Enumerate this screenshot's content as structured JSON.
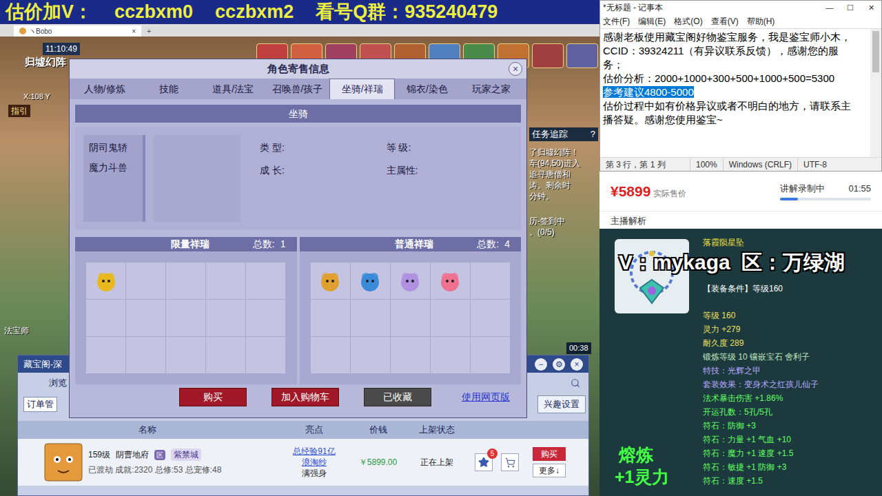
{
  "banner": {
    "parts": [
      "估价加V：",
      "cczbxm0",
      "cczbxm2",
      "看号Q群：935240479"
    ]
  },
  "game": {
    "tab": "ヽBobo",
    "tab_close": "×",
    "tab_add": "+",
    "hud": {
      "time": "11:10:49",
      "location": "归墟幻阵",
      "coords": "X:108 Y",
      "guide": "指引",
      "timer": "00:38",
      "npc": "法宝师"
    },
    "quest": {
      "title": "任务追踪",
      "help": "?",
      "lines": [
        "了归墟幻阵！",
        "车(94,50)进入",
        "追寻唐僧和",
        "涛。剩余时",
        "分钟。"
      ]
    },
    "calendar": [
      "历-签到中",
      "。(0/5)"
    ]
  },
  "dialog": {
    "title": "角色寄售信息",
    "close": "×",
    "tabs": [
      {
        "label": "人物/修炼",
        "selected": false
      },
      {
        "label": "技能",
        "selected": false
      },
      {
        "label": "道具/法宝",
        "selected": false
      },
      {
        "label": "召唤兽/孩子",
        "selected": false
      },
      {
        "label": "坐骑/祥瑞",
        "selected": true
      },
      {
        "label": "锦衣/染色",
        "selected": false
      },
      {
        "label": "玩家之家",
        "selected": false
      }
    ],
    "section": "坐骑",
    "mounts": [
      {
        "name": "阴司鬼轿",
        "selected": false
      },
      {
        "name": "魔力斗兽",
        "selected": false
      }
    ],
    "fields": [
      "类 型:",
      "等 级:",
      "成 长:",
      "主属性:"
    ],
    "limited": {
      "title": "限量祥瑞",
      "count_label": "总数:",
      "count": "1",
      "items": [
        {
          "color": "#e8b820"
        }
      ]
    },
    "normal": {
      "title": "普通祥瑞",
      "count_label": "总数:",
      "count": "4",
      "items": [
        {
          "color": "#e0a030"
        },
        {
          "color": "#3a8ad8"
        },
        {
          "color": "#b090e0"
        },
        {
          "color": "#f07090"
        }
      ]
    },
    "buttons": [
      {
        "label": "购买",
        "kind": "red"
      },
      {
        "label": "加入购物车",
        "kind": "red"
      },
      {
        "label": "已收藏",
        "kind": "gray"
      },
      {
        "label": "使用网页版",
        "kind": "link"
      }
    ]
  },
  "market": {
    "title": "藏宝阁-深",
    "window_buttons": [
      "−",
      "⚙",
      "×"
    ],
    "browse": "浏览",
    "orders": "订单管",
    "interest": "兴趣设置",
    "columns": [
      "名称",
      "亮点",
      "价钱",
      "上架状态"
    ],
    "rows": [
      {
        "level": "159级",
        "school": "阴曹地府",
        "tag": "区",
        "server": "紫禁城",
        "detail": "已渡劫 成就:2320 总修:53 总宠修:48",
        "highlights": [
          {
            "text": "总经验91亿",
            "link": true
          },
          {
            "text": "浪淘纱",
            "link": true
          },
          {
            "text": "满强身",
            "link": false
          }
        ],
        "price": "￥5899.00",
        "status": "正在上架",
        "stars": "5",
        "buy": "购买",
        "more": "更多↓"
      }
    ]
  },
  "notepad": {
    "title": "*无标题 - 记事本",
    "controls": [
      "—",
      "☐",
      "✕"
    ],
    "menu": [
      "文件(F)",
      "编辑(E)",
      "格式(O)",
      "查看(V)",
      "帮助(H)"
    ],
    "lines": [
      {
        "text": "感谢老板使用藏宝阁好物鉴宝服务，我是鉴宝师小木，",
        "selected": false
      },
      {
        "text": "CCID：39324211（有异议联系反馈），感谢您的服",
        "selected": false
      },
      {
        "text": "务；",
        "selected": false
      },
      {
        "text": "估价分析：2000+1000+300+500+1000+500=5300",
        "selected": false
      },
      {
        "text": "参考建议4800-5000",
        "selected": true
      },
      {
        "text": "估价过程中如有价格异议或者不明白的地方，请联系主",
        "selected": false
      },
      {
        "text": "播答疑。感谢您使用鉴宝~",
        "selected": false
      }
    ],
    "status": [
      "第 3 行，第 1 列",
      "100%",
      "Windows (CRLF)",
      "UTF-8"
    ]
  },
  "sale": {
    "price": "¥5899",
    "price_label": "实际售价",
    "recording": "讲解录制中",
    "time": "01:55",
    "level": 0.2,
    "section": "主播解析"
  },
  "tooltip": {
    "overlay": "V：mykaga  区：万绿湖",
    "name": "落霞陨星坠",
    "requirement": "【装备条件】等级160",
    "stats": [
      {
        "text": "等级 160",
        "color": "#f0e060"
      },
      {
        "text": "灵力 +279",
        "color": "#f0e060"
      },
      {
        "text": "耐久度 289",
        "color": "#f0e060"
      },
      {
        "text": "锻炼等级 10 镶嵌宝石 舍利子",
        "color": "#c0e8c0"
      },
      {
        "text": "特技：光辉之甲",
        "color": "#b8a8ff"
      },
      {
        "text": "套装效果：变身术之红孩儿仙子",
        "color": "#b8a8ff"
      },
      {
        "text": "法术暴击伤害 +1.86%",
        "color": "#60ff60"
      },
      {
        "text": "开运孔数：5孔/5孔",
        "color": "#60ff60"
      },
      {
        "text": "符石：防御 +3",
        "color": "#60ff60"
      },
      {
        "text": "符石：力量 +1 气血 +10",
        "color": "#60ff60"
      },
      {
        "text": "符石：魔力 +1 速度 +1.5",
        "color": "#60ff60"
      },
      {
        "text": "符石：敏捷 +1 防御 +3",
        "color": "#60ff60"
      },
      {
        "text": "符石：速度 +1.5",
        "color": "#60ff60"
      }
    ],
    "melt": [
      "熔炼",
      "+1灵力"
    ]
  }
}
